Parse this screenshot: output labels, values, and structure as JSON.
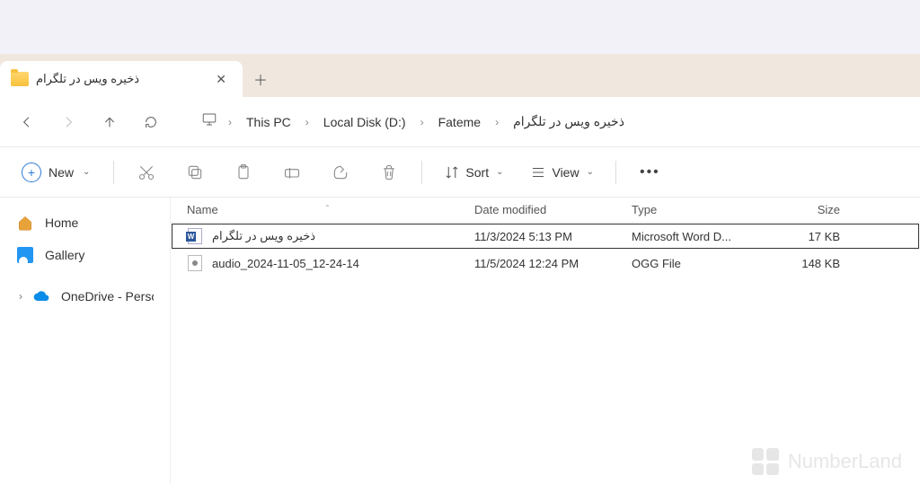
{
  "tab": {
    "title": "ذخیره ویس در تلگرام"
  },
  "breadcrumb": {
    "items": [
      "This PC",
      "Local Disk (D:)",
      "Fateme",
      "ذخیره ویس در تلگرام"
    ]
  },
  "toolbar": {
    "new_label": "New",
    "sort_label": "Sort",
    "view_label": "View"
  },
  "sidebar": {
    "home": "Home",
    "gallery": "Gallery",
    "onedrive": "OneDrive - Persona"
  },
  "columns": {
    "name": "Name",
    "date_modified": "Date modified",
    "type": "Type",
    "size": "Size"
  },
  "files": [
    {
      "name": "ذخیره ویس در تلگرام",
      "date": "11/3/2024 5:13 PM",
      "type": "Microsoft Word D...",
      "size": "17 KB",
      "icon": "word",
      "selected": true
    },
    {
      "name": "audio_2024-11-05_12-24-14",
      "date": "11/5/2024 12:24 PM",
      "type": "OGG File",
      "size": "148 KB",
      "icon": "ogg",
      "selected": false
    }
  ],
  "watermark": {
    "brand": "NumberLand"
  }
}
